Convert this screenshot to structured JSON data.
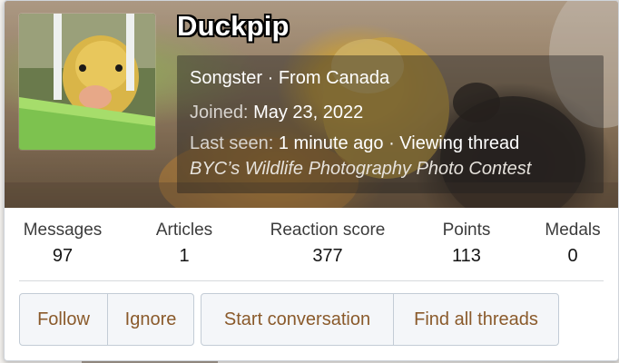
{
  "profile": {
    "username": "Duckpip",
    "title": "Songster",
    "location_prefix": "From",
    "location": "Canada",
    "joined_label": "Joined:",
    "joined_value": "May 23, 2022",
    "last_seen_label": "Last seen:",
    "last_seen_value": "1 minute ago",
    "activity": "Viewing thread",
    "activity_thread": "BYC’s Wildlife Photography Photo Contest"
  },
  "stats": [
    {
      "label": "Messages",
      "value": "97"
    },
    {
      "label": "Articles",
      "value": "1"
    },
    {
      "label": "Reaction score",
      "value": "377"
    },
    {
      "label": "Points",
      "value": "113"
    },
    {
      "label": "Medals",
      "value": "0"
    }
  ],
  "actions": {
    "follow": "Follow",
    "ignore": "Ignore",
    "start_conversation": "Start conversation",
    "find_all_threads": "Find all threads"
  },
  "colors": {
    "button_text": "#8a5a2b",
    "button_bg": "#f4f6f9",
    "username_text": "#ffffff"
  }
}
